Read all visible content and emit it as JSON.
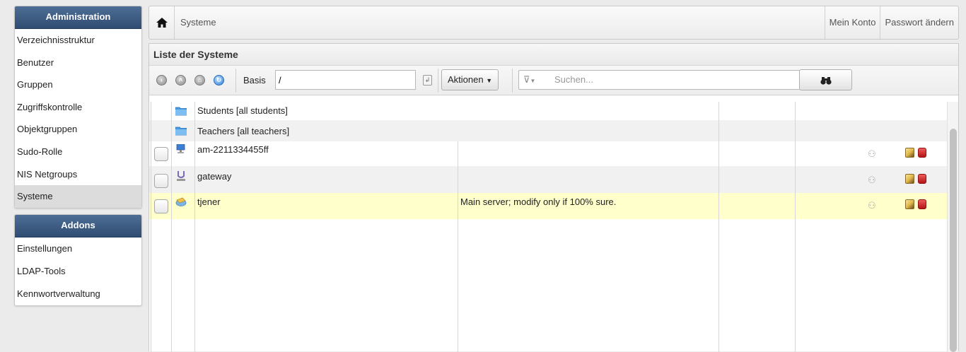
{
  "sidebar": {
    "admin_title": "Administration",
    "admin_items": [
      {
        "label": "Verzeichnisstruktur"
      },
      {
        "label": "Benutzer"
      },
      {
        "label": "Gruppen"
      },
      {
        "label": "Zugriffskontrolle"
      },
      {
        "label": "Objektgruppen"
      },
      {
        "label": "Sudo-Rolle"
      },
      {
        "label": "NIS Netgroups"
      },
      {
        "label": "Systeme",
        "active": true
      }
    ],
    "addons_title": "Addons",
    "addons_items": [
      {
        "label": "Einstellungen"
      },
      {
        "label": "LDAP-Tools"
      },
      {
        "label": "Kennwortverwaltung"
      }
    ]
  },
  "header": {
    "home_icon": "home-icon",
    "breadcrumb": "Systeme",
    "my_account": "Mein Konto",
    "change_password": "Passwort ändern"
  },
  "panel": {
    "title": "Liste der Systeme",
    "toolbar": {
      "basis_label": "Basis",
      "basis_value": "/",
      "actions_label": "Aktionen",
      "search_placeholder": "Suchen..."
    },
    "rows": [
      {
        "name": "Students [all students]",
        "type": "folder",
        "description": ""
      },
      {
        "name": "Teachers [all teachers]",
        "type": "folder",
        "description": ""
      },
      {
        "name": "am-2211334455ff",
        "type": "workstation",
        "description": ""
      },
      {
        "name": "gateway",
        "type": "network-device",
        "description": ""
      },
      {
        "name": "tjener",
        "type": "server",
        "description": "Main server; modify only if 100% sure."
      }
    ]
  },
  "colors": {
    "menu_header": "#3c5a80",
    "highlight_row": "#ffffcc",
    "active_menu": "#dcdcdc"
  }
}
